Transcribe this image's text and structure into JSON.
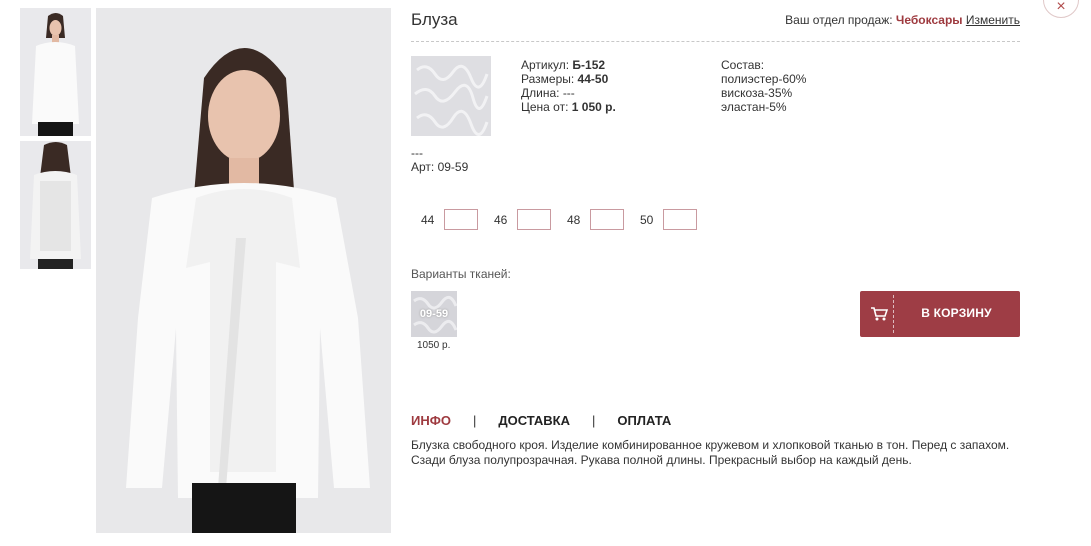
{
  "product": {
    "title": "Блуза",
    "close_symbol": "×"
  },
  "department": {
    "label": "Ваш отдел продаж:",
    "city": "Чебоксары",
    "change": "Изменить"
  },
  "details": {
    "article_label": "Артикул:",
    "article_value": "Б-152",
    "sizes_label": "Размеры:",
    "sizes_value": "44-50",
    "length_label": "Длина:",
    "length_value": "---",
    "price_label": "Цена от:",
    "price_value": "1 050 р."
  },
  "composition": {
    "label": "Состав:",
    "items": [
      "полиэстер-60%",
      "вискоза-35%",
      "эластан-5%"
    ]
  },
  "fabric": {
    "dashes": "---",
    "art": "Арт: 09-59"
  },
  "sizes": [
    {
      "label": "44",
      "value": ""
    },
    {
      "label": "46",
      "value": ""
    },
    {
      "label": "48",
      "value": ""
    },
    {
      "label": "50",
      "value": ""
    }
  ],
  "variants": {
    "label": "Варианты тканей:",
    "items": [
      {
        "code": "09-59",
        "price": "1050 р."
      }
    ]
  },
  "cart": {
    "label": "В КОРЗИНУ"
  },
  "tabs": {
    "items": [
      "ИНФО",
      "ДОСТАВКА",
      "ОПЛАТА"
    ],
    "separator": "|",
    "active": 0
  },
  "description": "Блузка свободного кроя. Изделие комбинированное кружевом и хлопковой тканью в тон. Перед с запахом. Сзади блуза полупрозрачная. Рукава полной длины. Прекрасный выбор на каждый день.",
  "colors": {
    "accent": "#9e3d45",
    "background": "#ffffff"
  }
}
